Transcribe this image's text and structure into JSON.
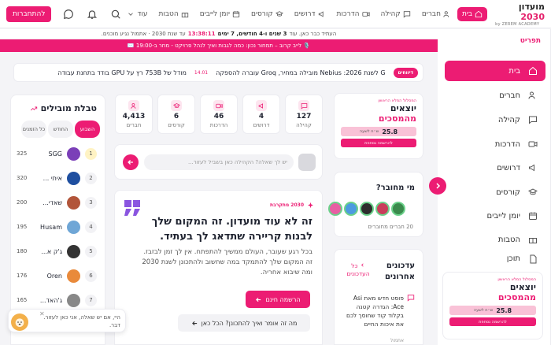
{
  "nav": {
    "logo_title_a": "מועדון ",
    "logo_title_b": "2030",
    "logo_sub": "by ZEREM ACADEMY",
    "items": [
      "בית",
      "חברים",
      "קהילה",
      "הדרכות",
      "דרושים",
      "קורסים",
      "יומן לייבים",
      "הטבות",
      "עוד"
    ],
    "signup": "להתחברות"
  },
  "counter": {
    "prefix": "העתיד כבר כאן. עוד",
    "duration": "3 שנים ו-4 חודשים, 7 ימים",
    "clock": "13:38:11",
    "suffix": "עד שנת 2030 · אתמול נגיע מוכנים."
  },
  "ticker": {
    "text": "🎙️ לייב קרוב – תמחור נכון: כמה לגבות ואיך לנהל פרויקט - מחר ב-19:00 ✉️"
  },
  "news": {
    "badge": "דיווחים",
    "item1": "G לשנת 2026: Nebius מובילה במחיר, Groq עוברה להספקה",
    "num": "14.01",
    "item2": "מודל של 753B רץ על GPU בודד בתחנת עבודה"
  },
  "sidebar": {
    "title": "תפריט",
    "items": [
      "בית",
      "חברים",
      "קהילה",
      "הדרכות",
      "דרושים",
      "קורסים",
      "יומן לייבים",
      "הטבות",
      "תוכן"
    ]
  },
  "promo": {
    "kicker": "המסלול המלא הראשון",
    "title": "יוצאים",
    "subtitle": "מהמסכים",
    "price": "25.8",
    "price_note": "ש״ח לשעה",
    "cta": "להרשמה נסחפת"
  },
  "stats": [
    {
      "value": "127",
      "label": "קהילה"
    },
    {
      "value": "4",
      "label": "דרושים"
    },
    {
      "value": "46",
      "label": "הדרכות"
    },
    {
      "value": "6",
      "label": "קורסים"
    },
    {
      "value": "4,413",
      "label": "חברים"
    }
  ],
  "composer": {
    "placeholder": "יש לך שאלה? הקהילה כאן בשביל לעזור..."
  },
  "hero": {
    "tag": "2030 מתקרבת",
    "title": "זה לא עוד מועדון. זה המקום שלך לבנות קריירה שתדאג לך בעתיד.",
    "body": "בכל רגע שעובר, העולם ממשיך להתפתח. אין לך זמן לבזבז. זה המקום שלך להתמקד במה שחשוב ולהתכונן לשנת 2030 ומה שיבוא אחריה.",
    "cta": "הרשמה חינם",
    "secondary": "מה זה אומר ואיך להתכונן? הכל כאן"
  },
  "leaderboard": {
    "title": "טבלת מובילים",
    "tabs": [
      "השבוע",
      "החודש",
      "כל הזמנים"
    ],
    "rows": [
      {
        "rank": "1",
        "name": "SGG",
        "pts": "325",
        "color": "#7b3fb8"
      },
      {
        "rank": "2",
        "name": "איתי ...",
        "pts": "320",
        "color": "#1f4fa0"
      },
      {
        "rank": "3",
        "name": "שאדי...",
        "pts": "200",
        "color": "#b2553a"
      },
      {
        "rank": "4",
        "name": "Husam",
        "pts": "195",
        "color": "#6fa6d6"
      },
      {
        "rank": "5",
        "name": "ג'ק א...",
        "pts": "180",
        "color": "#333333"
      },
      {
        "rank": "6",
        "name": "Oren",
        "pts": "176",
        "color": "#e98a3b"
      },
      {
        "rank": "7",
        "name": "ג'האד...",
        "pts": "165",
        "color": "#888888"
      }
    ]
  },
  "online": {
    "title": "מי מחובר?",
    "count": "20 חברים מחוברים",
    "colors": [
      "#3b8a4c",
      "#c93d5b",
      "#2d2d2d",
      "#4d9be0",
      "#e75fa3"
    ]
  },
  "updates": {
    "title": "עדכונים אחרונים",
    "all": "כל העדכונים",
    "item": "פוסט חדש מאת Asi Ace: הגדרה קטנה בקלוד קוד שחוסך לכם את איכות החיים",
    "author": "אתמול"
  },
  "chat": {
    "text": "היי, אם יש שאלה, אני כאן לעזור. דבר."
  }
}
